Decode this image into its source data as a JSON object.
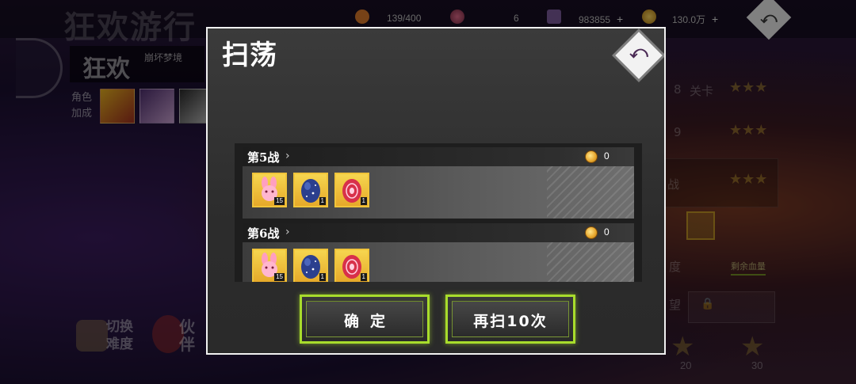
{
  "background": {
    "title": "狂欢游行",
    "stage_name": "狂欢",
    "stage_desc": "崩坏梦境",
    "bonus_label": "角色\n加成",
    "resources": [
      {
        "icon": "carrot-icon",
        "value": "139/400"
      },
      {
        "icon": "egg-icon",
        "value": "6"
      },
      {
        "icon": "crystal-icon",
        "value": "983855",
        "plus": "+"
      },
      {
        "icon": "gold-coin-icon",
        "value": "130.0万",
        "plus": "+"
      }
    ],
    "right_texts": [
      "8",
      "关卡",
      "9",
      "战"
    ],
    "remaining_hp_label": "剩余血量",
    "right_partial_1": "度",
    "right_partial_2": "望",
    "switch_difficulty": "切换\n难度",
    "partner": "伙\n伴",
    "progress_numbers": [
      "20",
      "30"
    ]
  },
  "modal": {
    "title": "扫荡",
    "battles": [
      {
        "name": "第5战",
        "coins": "0",
        "items": [
          {
            "icon": "bunny-icon",
            "count": "15"
          },
          {
            "icon": "blue-star-egg-icon",
            "count": "1"
          },
          {
            "icon": "red-pattern-egg-icon",
            "count": "1"
          }
        ]
      },
      {
        "name": "第6战",
        "coins": "0",
        "items": [
          {
            "icon": "bunny-icon",
            "count": "15"
          },
          {
            "icon": "blue-star-egg-icon",
            "count": "1"
          },
          {
            "icon": "red-pattern-egg-icon",
            "count": "1"
          }
        ]
      }
    ],
    "confirm_label": "确定",
    "resweep_label": "再扫10次"
  },
  "colors": {
    "accent_green": "#a8dc2c",
    "item_gold": "#f0c43a",
    "modal_border": "#f1f1f1"
  }
}
